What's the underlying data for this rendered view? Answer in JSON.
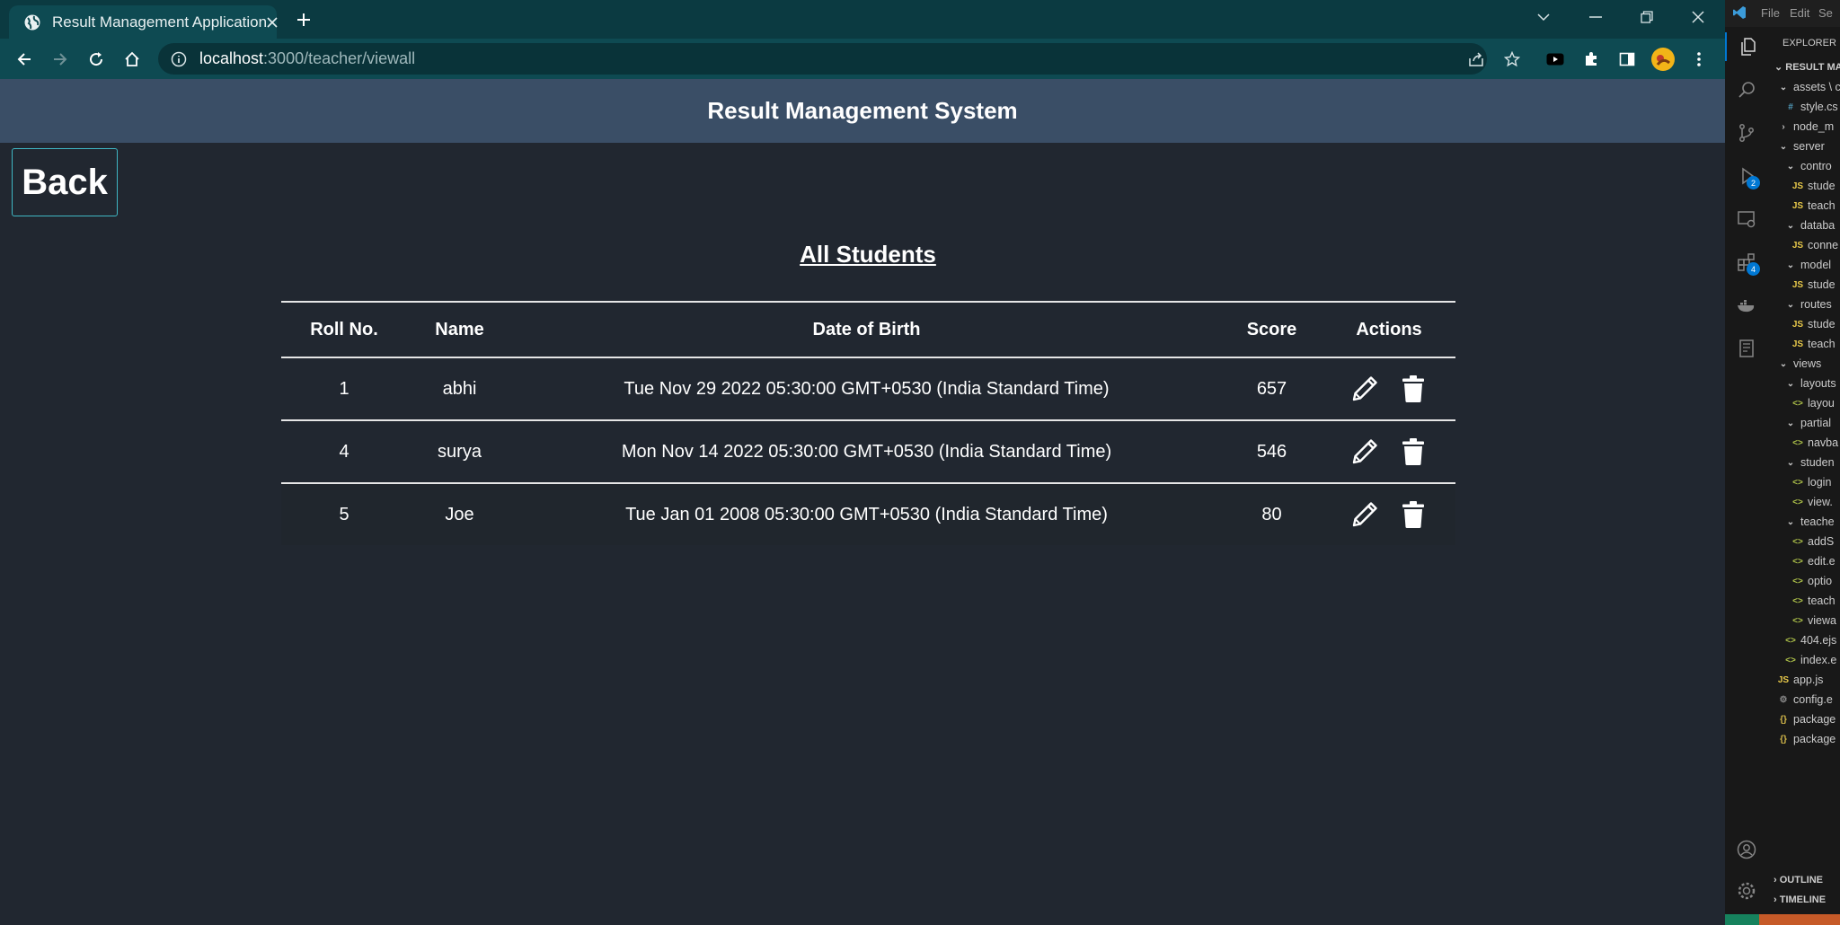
{
  "browser": {
    "tab_title": "Result Management Application",
    "url_host": "localhost",
    "url_path": ":3000/teacher/viewall"
  },
  "page": {
    "header_title": "Result Management System",
    "back_label": "Back",
    "title": "All Students",
    "columns": [
      "Roll No.",
      "Name",
      "Date of Birth",
      "Score",
      "Actions"
    ],
    "students": [
      {
        "roll": "1",
        "name": "abhi",
        "dob": "Tue Nov 29 2022 05:30:00 GMT+0530 (India Standard Time)",
        "score": "657"
      },
      {
        "roll": "4",
        "name": "surya",
        "dob": "Mon Nov 14 2022 05:30:00 GMT+0530 (India Standard Time)",
        "score": "546"
      },
      {
        "roll": "5",
        "name": "Joe",
        "dob": "Tue Jan 01 2008 05:30:00 GMT+0530 (India Standard Time)",
        "score": "80"
      }
    ]
  },
  "vscode": {
    "menu": [
      "File",
      "Edit",
      "Se"
    ],
    "explorer_title": "EXPLORER",
    "section": "RESULT MA",
    "badges": {
      "run_debug": "2",
      "extensions": "4"
    },
    "tree": [
      {
        "label": "assets \\ c",
        "icon": "chevron-down",
        "indent": 1
      },
      {
        "label": "style.cs",
        "icon": "css",
        "indent": 2
      },
      {
        "label": "node_m",
        "icon": "chevron-right",
        "indent": 1
      },
      {
        "label": "server",
        "icon": "chevron-down",
        "indent": 1
      },
      {
        "label": "contro",
        "icon": "chevron-down",
        "indent": 2
      },
      {
        "label": "stude",
        "icon": "js",
        "indent": 3
      },
      {
        "label": "teach",
        "icon": "js",
        "indent": 3
      },
      {
        "label": "databa",
        "icon": "chevron-down",
        "indent": 2
      },
      {
        "label": "conne",
        "icon": "js",
        "indent": 3
      },
      {
        "label": "model",
        "icon": "chevron-down",
        "indent": 2
      },
      {
        "label": "stude",
        "icon": "js",
        "indent": 3
      },
      {
        "label": "routes",
        "icon": "chevron-down",
        "indent": 2
      },
      {
        "label": "stude",
        "icon": "js",
        "indent": 3
      },
      {
        "label": "teach",
        "icon": "js",
        "indent": 3
      },
      {
        "label": "views",
        "icon": "chevron-down",
        "indent": 1
      },
      {
        "label": "layouts",
        "icon": "chevron-down",
        "indent": 2
      },
      {
        "label": "layou",
        "icon": "ejs",
        "indent": 3
      },
      {
        "label": "partial",
        "icon": "chevron-down",
        "indent": 2
      },
      {
        "label": "navba",
        "icon": "ejs",
        "indent": 3
      },
      {
        "label": "studen",
        "icon": "chevron-down",
        "indent": 2
      },
      {
        "label": "login",
        "icon": "ejs",
        "indent": 3
      },
      {
        "label": "view.",
        "icon": "ejs",
        "indent": 3
      },
      {
        "label": "teache",
        "icon": "chevron-down",
        "indent": 2
      },
      {
        "label": "addS",
        "icon": "ejs",
        "indent": 3
      },
      {
        "label": "edit.e",
        "icon": "ejs",
        "indent": 3
      },
      {
        "label": "optio",
        "icon": "ejs",
        "indent": 3
      },
      {
        "label": "teach",
        "icon": "ejs",
        "indent": 3
      },
      {
        "label": "viewa",
        "icon": "ejs",
        "indent": 3
      },
      {
        "label": "404.ejs",
        "icon": "ejs",
        "indent": 2
      },
      {
        "label": "index.e",
        "icon": "ejs",
        "indent": 2
      },
      {
        "label": "app.js",
        "icon": "js",
        "indent": 1
      },
      {
        "label": "config.e",
        "icon": "gear",
        "indent": 1
      },
      {
        "label": "package",
        "icon": "json",
        "indent": 1
      },
      {
        "label": "package",
        "icon": "json",
        "indent": 1
      }
    ],
    "outline_label": "OUTLINE",
    "timeline_label": "TIMELINE"
  }
}
